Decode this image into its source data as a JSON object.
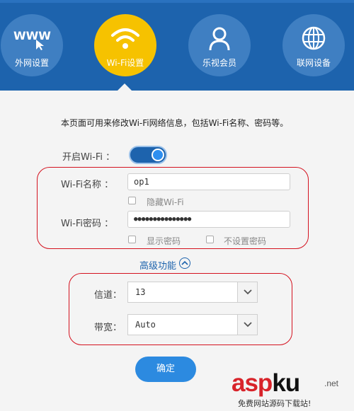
{
  "nav": {
    "items": [
      {
        "label": "外网设置",
        "icon": "www-icon"
      },
      {
        "label": "Wi-Fi设置",
        "icon": "wifi-icon"
      },
      {
        "label": "乐视会员",
        "icon": "user-icon"
      },
      {
        "label": "联网设备",
        "icon": "globe-icon"
      }
    ],
    "www_text": "WWW",
    "active_color": "#f6c200",
    "header_color": "#1d63ad"
  },
  "description": "本页面可用来修改Wi-Fi网络信息，包括Wi-Fi名称、密码等。",
  "wifi_enable": {
    "label": "开启Wi-Fi ：",
    "state": "on"
  },
  "wifi_name": {
    "label": "Wi-Fi名称 ：",
    "value": "op1"
  },
  "hide_ssid": {
    "label": "隐藏Wi-Fi",
    "checked": false
  },
  "wifi_password": {
    "label": "Wi-Fi密码 ：",
    "value": "●●●●●●●●●●●●●●●"
  },
  "show_password": {
    "label": "显示密码",
    "checked": false
  },
  "no_password": {
    "label": "不设置密码",
    "checked": false
  },
  "advanced": {
    "label": "高级功能"
  },
  "channel": {
    "label": "信道：",
    "value": "13"
  },
  "bandwidth": {
    "label": "带宽：",
    "value": "Auto"
  },
  "confirm": {
    "label": "确定"
  },
  "watermark": {
    "main_red": "asp",
    "main_black": "ku",
    "suffix": ".net",
    "sub": "免费网站源码下载站!"
  }
}
